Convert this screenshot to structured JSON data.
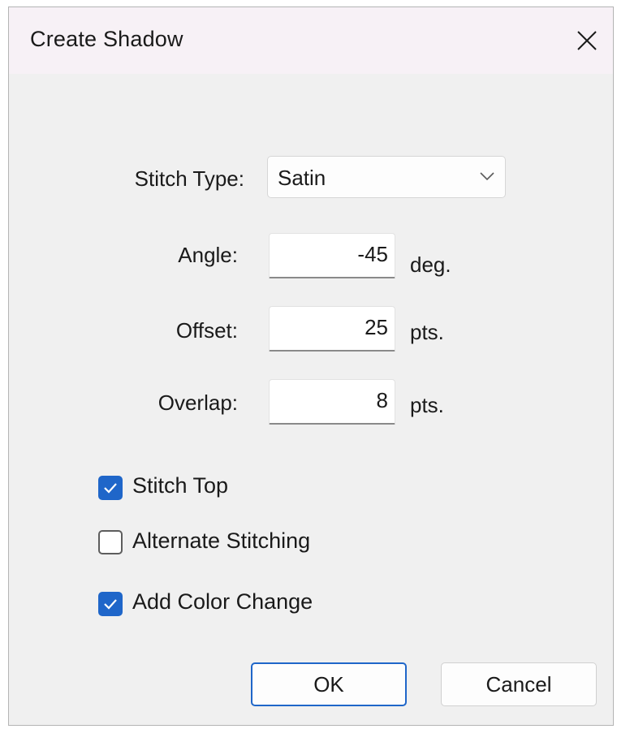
{
  "dialog": {
    "title": "Create Shadow",
    "close_icon": "close-icon"
  },
  "form": {
    "stitch_type": {
      "label": "Stitch Type:",
      "value": "Satin"
    },
    "angle": {
      "label": "Angle:",
      "value": "-45",
      "unit": "deg."
    },
    "offset": {
      "label": "Offset:",
      "value": "25",
      "unit": "pts."
    },
    "overlap": {
      "label": "Overlap:",
      "value": "8",
      "unit": "pts."
    }
  },
  "options": {
    "stitch_top": {
      "label": "Stitch Top",
      "checked": true
    },
    "alternate_stitching": {
      "label": "Alternate Stitching",
      "checked": false
    },
    "add_color_change": {
      "label": "Add Color Change",
      "checked": true
    }
  },
  "buttons": {
    "ok": "OK",
    "cancel": "Cancel"
  },
  "colors": {
    "accent": "#1f66c9",
    "dialog_bg": "#f0f0f0",
    "titlebar_bg": "#f7f1f6"
  }
}
